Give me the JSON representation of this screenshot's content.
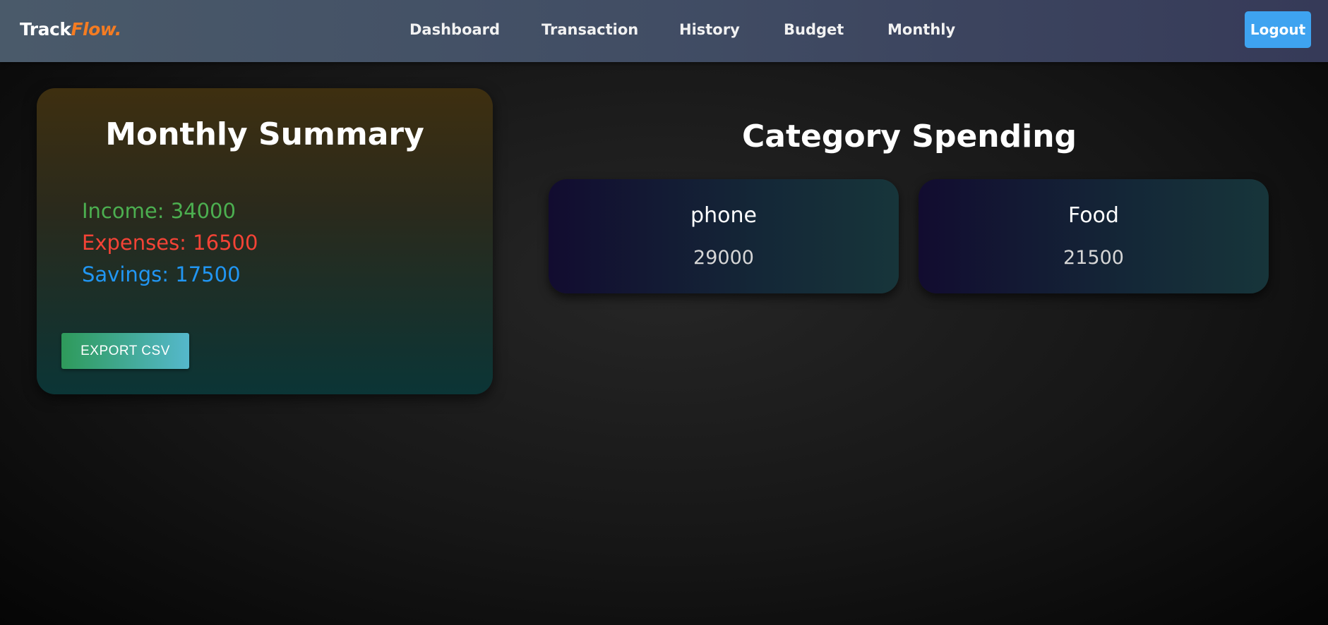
{
  "brand": {
    "part1": "Track",
    "part2": "Flow."
  },
  "nav": {
    "links": [
      "Dashboard",
      "Transaction",
      "History",
      "Budget",
      "Monthly"
    ],
    "logout_label": "Logout"
  },
  "summary": {
    "title": "Monthly Summary",
    "income": "Income: 34000",
    "expenses": "Expenses: 16500",
    "savings": "Savings: 17500",
    "export_label": "EXPORT CSV"
  },
  "categories": {
    "title": "Category Spending",
    "items": [
      {
        "name": "phone",
        "amount": "29000"
      },
      {
        "name": "Food",
        "amount": "21500"
      }
    ]
  },
  "colors": {
    "income": "#4caf50",
    "expenses": "#f44336",
    "savings": "#2196f3",
    "brand_accent": "#f57c22",
    "logout": "#3ea3f0"
  }
}
